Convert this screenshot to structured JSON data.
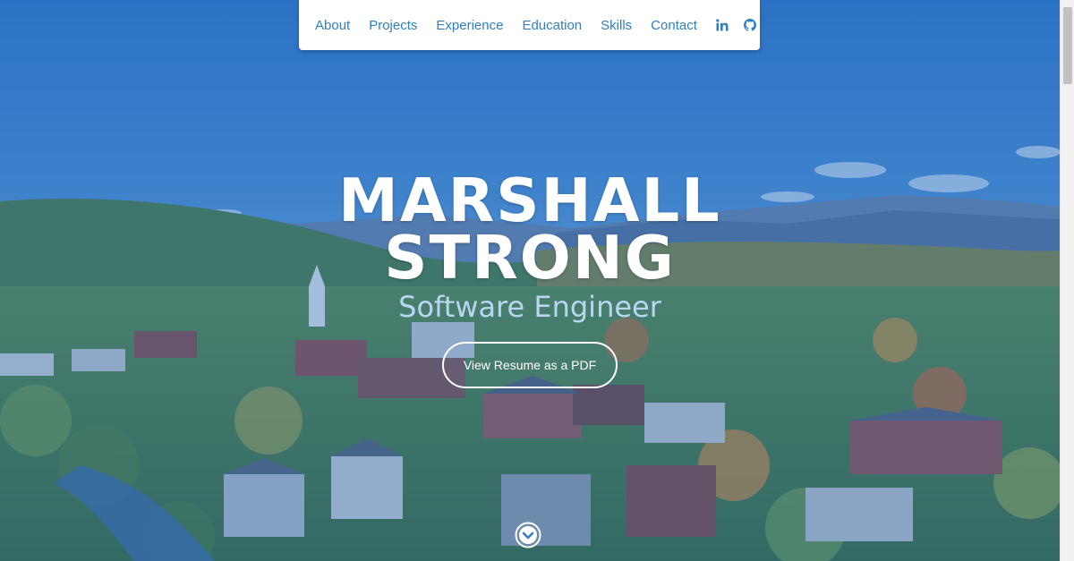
{
  "nav": {
    "items": [
      {
        "label": "About"
      },
      {
        "label": "Projects"
      },
      {
        "label": "Experience"
      },
      {
        "label": "Education"
      },
      {
        "label": "Skills"
      },
      {
        "label": "Contact"
      }
    ],
    "icons": [
      "linkedin-icon",
      "github-icon"
    ],
    "link_color": "#2f7fc2"
  },
  "hero": {
    "name_line1": "MARSHALL",
    "name_line2": "STRONG",
    "subtitle": "Software Engineer",
    "resume_button": "View Resume as a PDF",
    "scroll_icon": "chevron-down-circle-icon",
    "overlay_color": "#266abe"
  }
}
